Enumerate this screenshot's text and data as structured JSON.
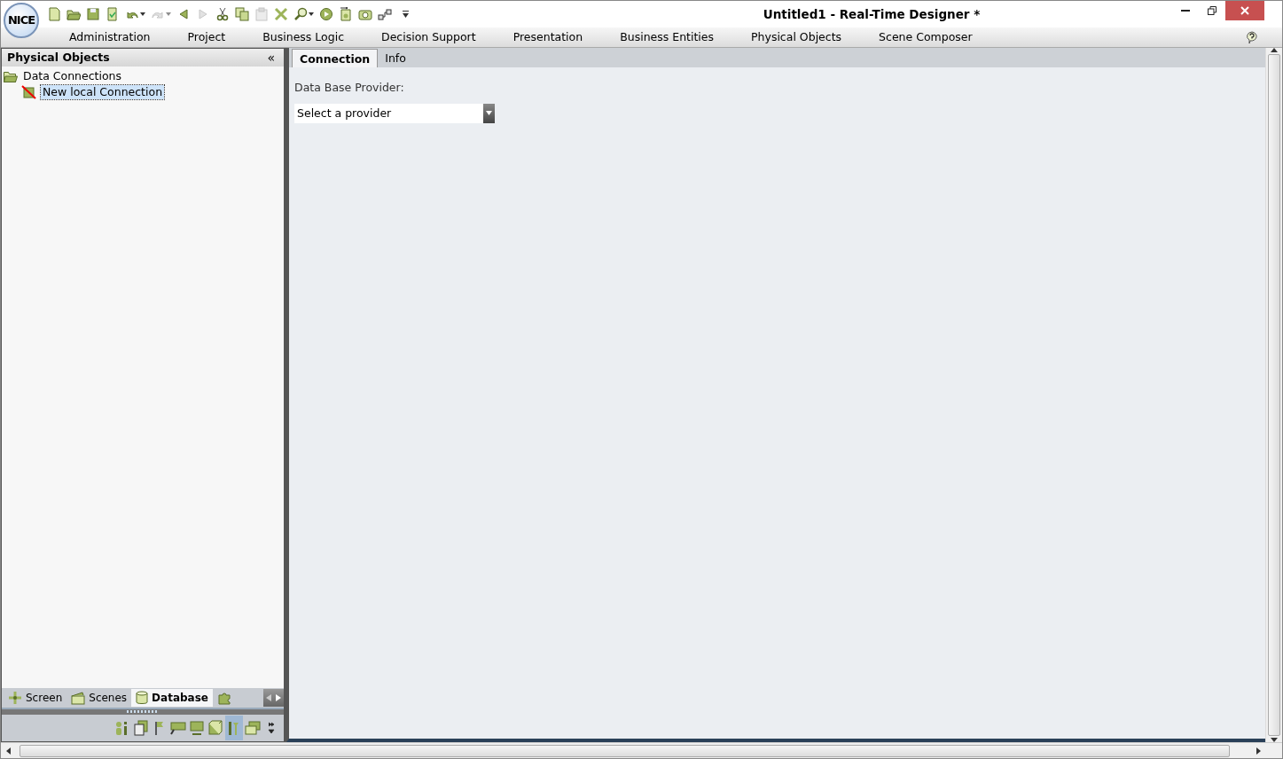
{
  "window": {
    "title": "Untitled1 - Real-Time Designer *",
    "logo": "NICE"
  },
  "toolbar": {
    "buttons": [
      {
        "disabled": false,
        "dropdown": false
      },
      {
        "disabled": false,
        "dropdown": false
      },
      {
        "disabled": false,
        "dropdown": false
      },
      {
        "disabled": false,
        "dropdown": false
      },
      {
        "disabled": false,
        "dropdown": true
      },
      {
        "disabled": true,
        "dropdown": true
      },
      {
        "disabled": false,
        "dropdown": false
      },
      {
        "disabled": true,
        "dropdown": false
      },
      {
        "disabled": false,
        "dropdown": false
      },
      {
        "disabled": false,
        "dropdown": false
      },
      {
        "disabled": true,
        "dropdown": false
      },
      {
        "disabled": false,
        "dropdown": false
      },
      {
        "disabled": false,
        "dropdown": true
      },
      {
        "disabled": false,
        "dropdown": false
      },
      {
        "disabled": false,
        "dropdown": false
      },
      {
        "disabled": false,
        "dropdown": false
      },
      {
        "disabled": false,
        "dropdown": false
      }
    ]
  },
  "menu": {
    "items": [
      "Administration",
      "Project",
      "Business Logic",
      "Decision Support",
      "Presentation",
      "Business Entities",
      "Physical Objects",
      "Scene Composer"
    ]
  },
  "sidebar": {
    "title": "Physical Objects",
    "collapse": "«",
    "tree": [
      {
        "label": "Data Connections",
        "selected": false,
        "children": [
          {
            "label": "New local Connection",
            "selected": true
          }
        ]
      }
    ],
    "tabs": [
      {
        "label": "Screen",
        "selected": false
      },
      {
        "label": "Scenes",
        "selected": false
      },
      {
        "label": "Database",
        "selected": true
      }
    ],
    "tools": [
      {
        "selected": false
      },
      {
        "selected": false
      },
      {
        "selected": false
      },
      {
        "selected": false
      },
      {
        "selected": false
      },
      {
        "selected": false
      },
      {
        "selected": true
      },
      {
        "selected": false
      }
    ]
  },
  "editor": {
    "tabs": [
      {
        "label": "Connection",
        "selected": true
      },
      {
        "label": "Info",
        "selected": false
      }
    ],
    "provider_label": "Data Base Provider:",
    "provider_select": {
      "placeholder": "Select a provider"
    }
  }
}
